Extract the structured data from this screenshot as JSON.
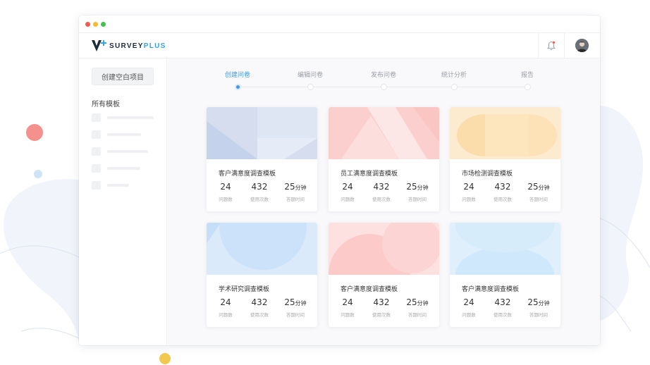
{
  "app": {
    "logo_part1": "SURVEY",
    "logo_part2": "PLUS"
  },
  "sidebar": {
    "create_button": "创建空白项目",
    "section_title": "所有模板"
  },
  "steps": [
    {
      "label": "创建问卷",
      "active": true
    },
    {
      "label": "编辑问卷",
      "active": false
    },
    {
      "label": "发布问卷",
      "active": false
    },
    {
      "label": "统计分析",
      "active": false
    },
    {
      "label": "报告",
      "active": false
    }
  ],
  "cards": [
    {
      "title": "客户满意度调查模板",
      "questions": "24",
      "uses": "432",
      "time": "25",
      "time_unit": "分钟",
      "questions_label": "问题数",
      "uses_label": "使用次数",
      "time_label": "答题时间",
      "theme": "#d3dcf0"
    },
    {
      "title": "员工满意度调查模板",
      "questions": "24",
      "uses": "432",
      "time": "25",
      "time_unit": "分钟",
      "questions_label": "问题数",
      "uses_label": "使用次数",
      "time_label": "答题时间",
      "theme": "#fbd0cf"
    },
    {
      "title": "市场检测调查模板",
      "questions": "24",
      "uses": "432",
      "time": "25",
      "time_unit": "分钟",
      "questions_label": "问题数",
      "uses_label": "使用次数",
      "time_label": "答题时间",
      "theme": "#fde6c4"
    },
    {
      "title": "学术研究调查模板",
      "questions": "24",
      "uses": "432",
      "time": "25",
      "time_unit": "分钟",
      "questions_label": "问题数",
      "uses_label": "使用次数",
      "time_label": "答题时间",
      "theme": "#d6e8fb"
    },
    {
      "title": "客户满意度调查模板",
      "questions": "24",
      "uses": "432",
      "time": "25",
      "time_unit": "分钟",
      "questions_label": "问题数",
      "uses_label": "使用次数",
      "time_label": "答题时间",
      "theme": "#fcd3d2"
    },
    {
      "title": "客户满意度调查模板",
      "questions": "24",
      "uses": "432",
      "time": "25",
      "time_unit": "分钟",
      "questions_label": "问题数",
      "uses_label": "使用次数",
      "time_label": "答题时间",
      "theme": "#d7ecfb"
    }
  ],
  "colors": {
    "accent": "#3e9be6",
    "brand_dark": "#1c2b3c",
    "brand_blue": "#36a3dc"
  }
}
